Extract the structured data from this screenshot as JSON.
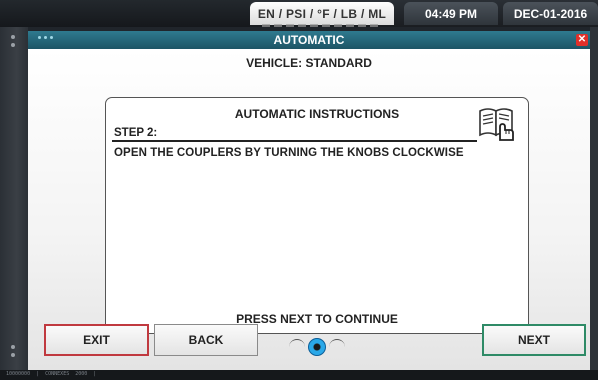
{
  "status_bar": {
    "units": "EN / PSI / °F / LB / ML",
    "time": "04:49 PM",
    "date": "DEC-01-2016"
  },
  "window": {
    "title": "AUTOMATIC",
    "close_icon": "close-icon",
    "accent_color": "#1d5465",
    "close_color": "#e0302a"
  },
  "content": {
    "vehicle": "VEHICLE: STANDARD",
    "panel_title": "AUTOMATIC INSTRUCTIONS",
    "step": "STEP 2:",
    "instruction": "OPEN THE COUPLERS BY TURNING THE KNOBS CLOCKWISE",
    "continue_text": "PRESS NEXT TO CONTINUE",
    "manual_icon": "manual-book-icon"
  },
  "pager": {
    "pages": 3,
    "current": 2,
    "active_color": "#2aa8e8"
  },
  "buttons": {
    "exit": "EXIT",
    "back": "BACK",
    "next": "NEXT",
    "exit_color": "#c0393f",
    "next_color": "#2e8a66"
  },
  "footer": {
    "text": "10000000  |  CONNEXES  2000  |"
  }
}
